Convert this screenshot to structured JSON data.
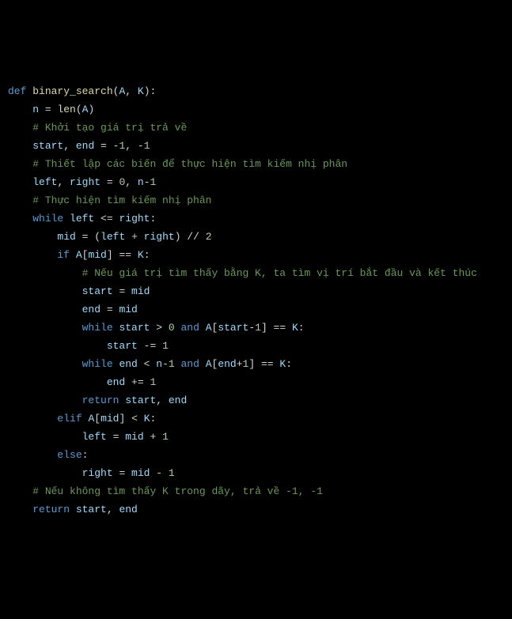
{
  "code": {
    "tokens": [
      [
        {
          "t": "def ",
          "c": "kw"
        },
        {
          "t": "binary_search",
          "c": "fn"
        },
        {
          "t": "(",
          "c": "punc"
        },
        {
          "t": "A",
          "c": "var"
        },
        {
          "t": ", ",
          "c": "punc"
        },
        {
          "t": "K",
          "c": "var"
        },
        {
          "t": "):",
          "c": "punc"
        }
      ],
      [
        {
          "t": "    ",
          "c": ""
        },
        {
          "t": "n",
          "c": "var"
        },
        {
          "t": " = ",
          "c": "op"
        },
        {
          "t": "len",
          "c": "builtin"
        },
        {
          "t": "(",
          "c": "punc"
        },
        {
          "t": "A",
          "c": "var"
        },
        {
          "t": ")",
          "c": "punc"
        }
      ],
      [
        {
          "t": "    ",
          "c": ""
        },
        {
          "t": "# Khởi tạo giá trị trả về",
          "c": "cmt"
        }
      ],
      [
        {
          "t": "    ",
          "c": ""
        },
        {
          "t": "start",
          "c": "var"
        },
        {
          "t": ", ",
          "c": "punc"
        },
        {
          "t": "end",
          "c": "var"
        },
        {
          "t": " = ",
          "c": "op"
        },
        {
          "t": "-",
          "c": "op"
        },
        {
          "t": "1",
          "c": "num"
        },
        {
          "t": ", ",
          "c": "punc"
        },
        {
          "t": "-",
          "c": "op"
        },
        {
          "t": "1",
          "c": "num"
        }
      ],
      [
        {
          "t": "    ",
          "c": ""
        },
        {
          "t": "# Thiết lập các biến để thực hiện tìm kiếm nhị phân",
          "c": "cmt"
        }
      ],
      [
        {
          "t": "    ",
          "c": ""
        },
        {
          "t": "left",
          "c": "var"
        },
        {
          "t": ", ",
          "c": "punc"
        },
        {
          "t": "right",
          "c": "var"
        },
        {
          "t": " = ",
          "c": "op"
        },
        {
          "t": "0",
          "c": "num"
        },
        {
          "t": ", ",
          "c": "punc"
        },
        {
          "t": "n",
          "c": "var"
        },
        {
          "t": "-",
          "c": "op"
        },
        {
          "t": "1",
          "c": "num"
        }
      ],
      [
        {
          "t": "    ",
          "c": ""
        },
        {
          "t": "# Thực hiện tìm kiếm nhị phân",
          "c": "cmt"
        }
      ],
      [
        {
          "t": "    ",
          "c": ""
        },
        {
          "t": "while ",
          "c": "kw"
        },
        {
          "t": "left",
          "c": "var"
        },
        {
          "t": " <= ",
          "c": "op"
        },
        {
          "t": "right",
          "c": "var"
        },
        {
          "t": ":",
          "c": "punc"
        }
      ],
      [
        {
          "t": "        ",
          "c": ""
        },
        {
          "t": "mid",
          "c": "var"
        },
        {
          "t": " = (",
          "c": "op"
        },
        {
          "t": "left",
          "c": "var"
        },
        {
          "t": " + ",
          "c": "op"
        },
        {
          "t": "right",
          "c": "var"
        },
        {
          "t": ") // ",
          "c": "op"
        },
        {
          "t": "2",
          "c": "num"
        }
      ],
      [
        {
          "t": "        ",
          "c": ""
        },
        {
          "t": "if ",
          "c": "kw"
        },
        {
          "t": "A",
          "c": "var"
        },
        {
          "t": "[",
          "c": "punc"
        },
        {
          "t": "mid",
          "c": "var"
        },
        {
          "t": "] == ",
          "c": "op"
        },
        {
          "t": "K",
          "c": "var"
        },
        {
          "t": ":",
          "c": "punc"
        }
      ],
      [
        {
          "t": "            ",
          "c": ""
        },
        {
          "t": "# Nếu giá trị tìm thấy bằng K, ta tìm vị trí bắt đầu và kết thúc",
          "c": "cmt"
        }
      ],
      [
        {
          "t": "            ",
          "c": ""
        },
        {
          "t": "start",
          "c": "var"
        },
        {
          "t": " = ",
          "c": "op"
        },
        {
          "t": "mid",
          "c": "var"
        }
      ],
      [
        {
          "t": "            ",
          "c": ""
        },
        {
          "t": "end",
          "c": "var"
        },
        {
          "t": " = ",
          "c": "op"
        },
        {
          "t": "mid",
          "c": "var"
        }
      ],
      [
        {
          "t": "            ",
          "c": ""
        },
        {
          "t": "while ",
          "c": "kw"
        },
        {
          "t": "start",
          "c": "var"
        },
        {
          "t": " > ",
          "c": "op"
        },
        {
          "t": "0",
          "c": "num"
        },
        {
          "t": " and ",
          "c": "kw"
        },
        {
          "t": "A",
          "c": "var"
        },
        {
          "t": "[",
          "c": "punc"
        },
        {
          "t": "start",
          "c": "var"
        },
        {
          "t": "-",
          "c": "op"
        },
        {
          "t": "1",
          "c": "num"
        },
        {
          "t": "] == ",
          "c": "op"
        },
        {
          "t": "K",
          "c": "var"
        },
        {
          "t": ":",
          "c": "punc"
        }
      ],
      [
        {
          "t": "                ",
          "c": ""
        },
        {
          "t": "start",
          "c": "var"
        },
        {
          "t": " -= ",
          "c": "op"
        },
        {
          "t": "1",
          "c": "num"
        }
      ],
      [
        {
          "t": "            ",
          "c": ""
        },
        {
          "t": "while ",
          "c": "kw"
        },
        {
          "t": "end",
          "c": "var"
        },
        {
          "t": " < ",
          "c": "op"
        },
        {
          "t": "n",
          "c": "var"
        },
        {
          "t": "-",
          "c": "op"
        },
        {
          "t": "1",
          "c": "num"
        },
        {
          "t": " and ",
          "c": "kw"
        },
        {
          "t": "A",
          "c": "var"
        },
        {
          "t": "[",
          "c": "punc"
        },
        {
          "t": "end",
          "c": "var"
        },
        {
          "t": "+",
          "c": "op"
        },
        {
          "t": "1",
          "c": "num"
        },
        {
          "t": "] == ",
          "c": "op"
        },
        {
          "t": "K",
          "c": "var"
        },
        {
          "t": ":",
          "c": "punc"
        }
      ],
      [
        {
          "t": "                ",
          "c": ""
        },
        {
          "t": "end",
          "c": "var"
        },
        {
          "t": " += ",
          "c": "op"
        },
        {
          "t": "1",
          "c": "num"
        }
      ],
      [
        {
          "t": "            ",
          "c": ""
        },
        {
          "t": "return ",
          "c": "kw"
        },
        {
          "t": "start",
          "c": "var"
        },
        {
          "t": ", ",
          "c": "punc"
        },
        {
          "t": "end",
          "c": "var"
        }
      ],
      [
        {
          "t": "        ",
          "c": ""
        },
        {
          "t": "elif ",
          "c": "kw"
        },
        {
          "t": "A",
          "c": "var"
        },
        {
          "t": "[",
          "c": "punc"
        },
        {
          "t": "mid",
          "c": "var"
        },
        {
          "t": "] < ",
          "c": "op"
        },
        {
          "t": "K",
          "c": "var"
        },
        {
          "t": ":",
          "c": "punc"
        }
      ],
      [
        {
          "t": "            ",
          "c": ""
        },
        {
          "t": "left",
          "c": "var"
        },
        {
          "t": " = ",
          "c": "op"
        },
        {
          "t": "mid",
          "c": "var"
        },
        {
          "t": " + ",
          "c": "op"
        },
        {
          "t": "1",
          "c": "num"
        }
      ],
      [
        {
          "t": "        ",
          "c": ""
        },
        {
          "t": "else",
          "c": "kw"
        },
        {
          "t": ":",
          "c": "punc"
        }
      ],
      [
        {
          "t": "            ",
          "c": ""
        },
        {
          "t": "right",
          "c": "var"
        },
        {
          "t": " = ",
          "c": "op"
        },
        {
          "t": "mid",
          "c": "var"
        },
        {
          "t": " - ",
          "c": "op"
        },
        {
          "t": "1",
          "c": "num"
        }
      ],
      [
        {
          "t": "    ",
          "c": ""
        },
        {
          "t": "# Nếu không tìm thấy K trong dãy, trả về -1, -1",
          "c": "cmt"
        }
      ],
      [
        {
          "t": "    ",
          "c": ""
        },
        {
          "t": "return ",
          "c": "kw"
        },
        {
          "t": "start",
          "c": "var"
        },
        {
          "t": ", ",
          "c": "punc"
        },
        {
          "t": "end",
          "c": "var"
        }
      ]
    ]
  }
}
